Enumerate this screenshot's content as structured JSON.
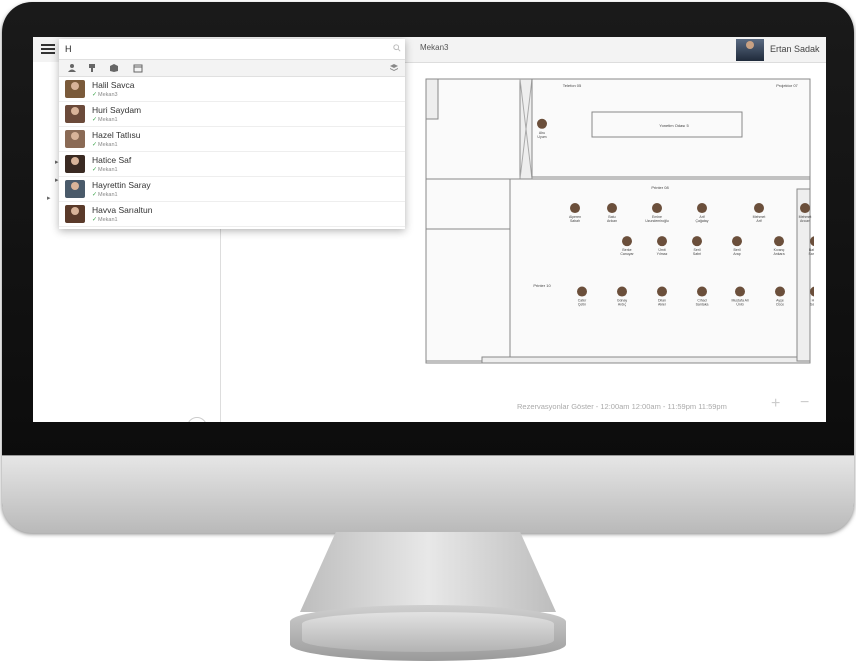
{
  "topbar": {
    "breadcrumb": "Mekan3",
    "user_name": "Ertan Sadak"
  },
  "search": {
    "query": "H",
    "filters": [
      "person-icon",
      "seat-icon",
      "room-icon",
      "calendar-icon",
      "layers-icon"
    ],
    "results": [
      {
        "name": "Halil Savca",
        "location": "Mekan3",
        "avatar_color": "#7a5a3a"
      },
      {
        "name": "Huri Saydam",
        "location": "Mekan1",
        "avatar_color": "#6b4a3a"
      },
      {
        "name": "Hazel Tatlısu",
        "location": "Mekan1",
        "avatar_color": "#8a6a55"
      },
      {
        "name": "Hatice Saf",
        "location": "Mekan1",
        "avatar_color": "#3a2a22"
      },
      {
        "name": "Hayrettin Saray",
        "location": "Mekan1",
        "avatar_color": "#4a5a6a"
      },
      {
        "name": "Havva Sarıaltun",
        "location": "Mekan1",
        "avatar_color": "#5a3a2a"
      }
    ]
  },
  "plan": {
    "rooms": {
      "telefon": "Telefon 05",
      "projektor": "Projektor 07",
      "meeting": "Yonetim Odası 5",
      "printer08": "Printer 08",
      "printer10": "Printer 10"
    },
    "people": [
      {
        "label": "Ahu Uyum"
      },
      {
        "label": "Alperen Sabah"
      },
      {
        "label": "Batu Arıkan"
      },
      {
        "label": "Emine Uzundemiroğlu"
      },
      {
        "label": "Arif Çağatay"
      },
      {
        "label": "Mehmet Arif"
      },
      {
        "label": "Mehmet Arıcan"
      },
      {
        "label": "Berke Canuyar"
      },
      {
        "label": "Ümit Yılmaz"
      },
      {
        "label": "Seril Sabri"
      },
      {
        "label": "Beril Arap"
      },
      {
        "label": "Kıvanç Ankara"
      },
      {
        "label": "Bahadır Saraçlar"
      },
      {
        "label": "Cafer Çetin"
      },
      {
        "label": "Günay Ardıç"
      },
      {
        "label": "Dilan Akier"
      },
      {
        "label": "Cihad Santaka"
      },
      {
        "label": "Mustafa Ali Ünlü"
      },
      {
        "label": "Ayşe Cüce"
      },
      {
        "label": "Halil Savca"
      }
    ]
  },
  "footer": {
    "reservations": "Rezervasyonlar Göster - 12:00am 12:00am - 11:59pm 11:59pm",
    "zoom_in": "+",
    "zoom_out": "−"
  },
  "sidebar": {
    "help": "?"
  }
}
